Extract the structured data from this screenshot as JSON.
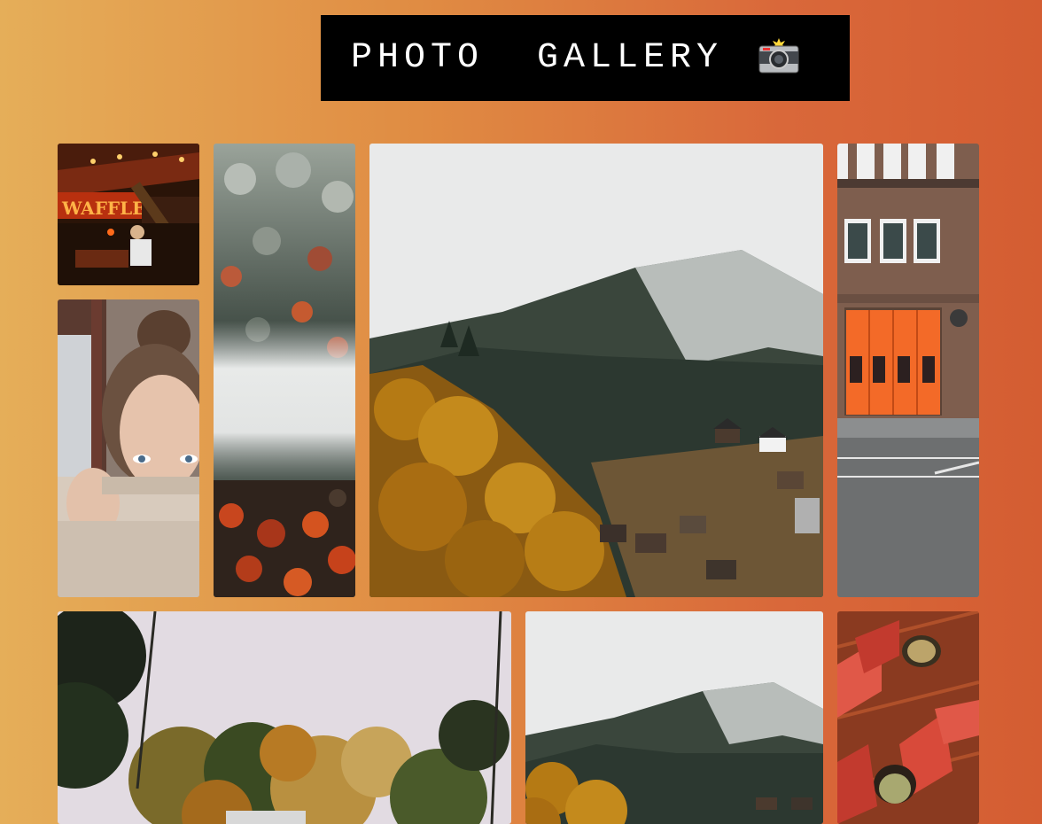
{
  "header": {
    "title": "PHOTO  GALLERY",
    "icon": "camera-with-flash-icon"
  },
  "photos": [
    {
      "id": "waffle-stand",
      "alt": "Waffle stand at night"
    },
    {
      "id": "frosted-forest",
      "alt": "Frosted forest with fog and autumn trees"
    },
    {
      "id": "foggy-mountain-village",
      "alt": "Foggy mountain village in autumn"
    },
    {
      "id": "fire-station",
      "alt": "Brick fire station with orange doors"
    },
    {
      "id": "woman-sweater",
      "alt": "Woman covering face with knit sweater"
    },
    {
      "id": "autumn-trees-sky",
      "alt": "Autumn trees under pale sky"
    },
    {
      "id": "foggy-mountain-village-2",
      "alt": "Foggy mountain village"
    },
    {
      "id": "red-shutters",
      "alt": "Brick building with red shutters"
    }
  ]
}
